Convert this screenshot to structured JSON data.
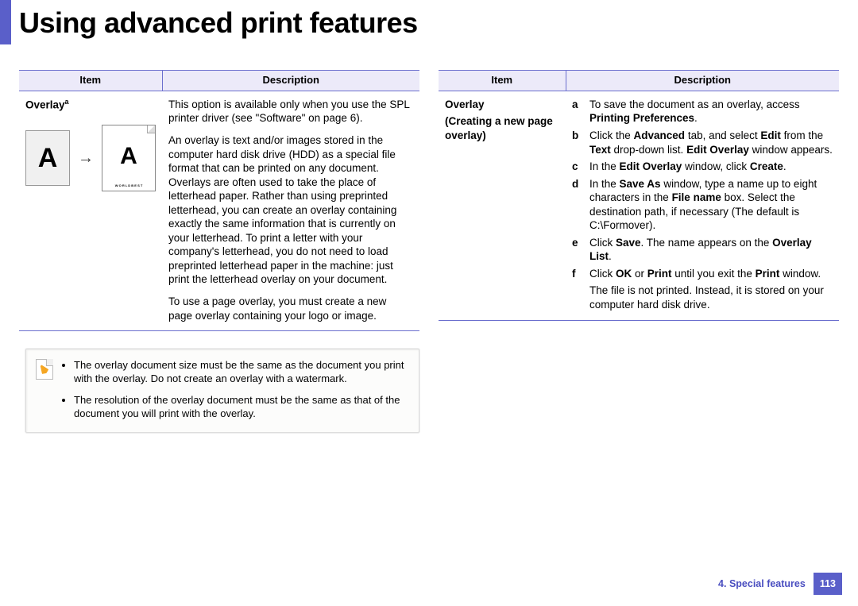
{
  "title": "Using advanced print features",
  "headers": {
    "item": "Item",
    "description": "Description"
  },
  "left": {
    "item_label": "Overlay",
    "item_foot": "a",
    "p1": "This option is available only when you use the SPL printer driver (see \"Software\" on page 6).",
    "p2": "An overlay is text and/or images stored in the computer hard disk drive (HDD) as a special file format that can be printed on any document. Overlays are often used to take the place of letterhead paper. Rather than using preprinted letterhead, you can create an overlay containing exactly the same information that is currently on your letterhead. To print a letter with your company's letterhead, you do not need to load preprinted letterhead paper in the machine: just print the letterhead overlay on your document.",
    "p3": "To use a page overlay, you must create a new page overlay containing your logo or image.",
    "diagram": {
      "A": "A",
      "B": "A",
      "caption": "W O R L D   B E S T"
    },
    "note": {
      "b1": "The overlay document size must be the same as the document you print with the overlay. Do not create an overlay with a watermark.",
      "b2": "The resolution of the overlay document must be the same as that of the document you will print with the overlay."
    }
  },
  "right": {
    "item_label": "Overlay",
    "item_sub_line1": "(Creating a new page",
    "item_sub_line2": "overlay)",
    "steps": {
      "a": {
        "l": "a",
        "pre": "To save the document as an overlay, access ",
        "b1": "Printing Preferences",
        "post": "."
      },
      "b": {
        "l": "b",
        "pre": "Click the ",
        "b1": "Advanced",
        "mid1": " tab, and select ",
        "b2": "Edit",
        "mid2": " from the ",
        "b3": "Text",
        "mid3": " drop-down list. ",
        "b4": "Edit Overlay",
        "post": " window appears."
      },
      "c": {
        "l": "c",
        "pre": "In the ",
        "b1": "Edit Overlay",
        "mid1": " window, click ",
        "b2": "Create",
        "post": "."
      },
      "d": {
        "l": "d",
        "pre": "In the ",
        "b1": "Save As",
        "mid1": " window, type a name up to eight characters in the ",
        "b2": "File name",
        "post": " box. Select the destination path, if necessary (The default is C:\\Formover)."
      },
      "e": {
        "l": "e",
        "pre": "Click ",
        "b1": "Save",
        "mid1": ". The name appears on the ",
        "b2": "Overlay List",
        "post": "."
      },
      "f": {
        "l": "f",
        "pre": "Click ",
        "b1": "OK",
        "mid1": " or ",
        "b2": "Print",
        "mid2": " until you exit the ",
        "b3": "Print",
        "post": " window."
      }
    },
    "tail": "The file is not printed. Instead, it is stored on your computer hard disk drive."
  },
  "footer": {
    "chapter": "4.  Special features",
    "page": "113"
  }
}
